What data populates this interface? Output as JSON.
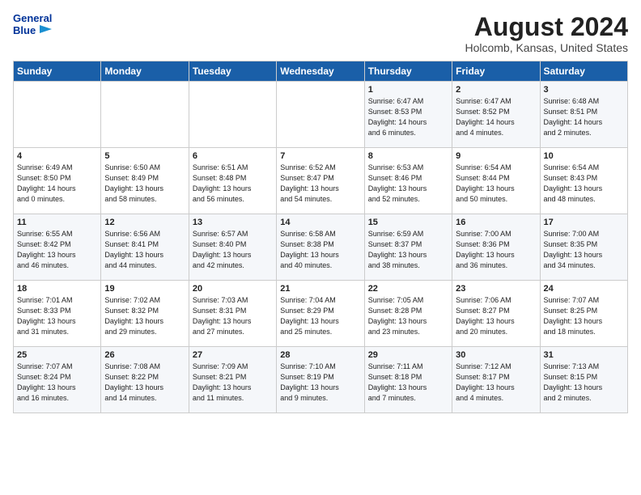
{
  "header": {
    "logo_line1": "General",
    "logo_line2": "Blue",
    "month_year": "August 2024",
    "location": "Holcomb, Kansas, United States"
  },
  "weekdays": [
    "Sunday",
    "Monday",
    "Tuesday",
    "Wednesday",
    "Thursday",
    "Friday",
    "Saturday"
  ],
  "weeks": [
    [
      {
        "day": "",
        "info": ""
      },
      {
        "day": "",
        "info": ""
      },
      {
        "day": "",
        "info": ""
      },
      {
        "day": "",
        "info": ""
      },
      {
        "day": "1",
        "info": "Sunrise: 6:47 AM\nSunset: 8:53 PM\nDaylight: 14 hours\nand 6 minutes."
      },
      {
        "day": "2",
        "info": "Sunrise: 6:47 AM\nSunset: 8:52 PM\nDaylight: 14 hours\nand 4 minutes."
      },
      {
        "day": "3",
        "info": "Sunrise: 6:48 AM\nSunset: 8:51 PM\nDaylight: 14 hours\nand 2 minutes."
      }
    ],
    [
      {
        "day": "4",
        "info": "Sunrise: 6:49 AM\nSunset: 8:50 PM\nDaylight: 14 hours\nand 0 minutes."
      },
      {
        "day": "5",
        "info": "Sunrise: 6:50 AM\nSunset: 8:49 PM\nDaylight: 13 hours\nand 58 minutes."
      },
      {
        "day": "6",
        "info": "Sunrise: 6:51 AM\nSunset: 8:48 PM\nDaylight: 13 hours\nand 56 minutes."
      },
      {
        "day": "7",
        "info": "Sunrise: 6:52 AM\nSunset: 8:47 PM\nDaylight: 13 hours\nand 54 minutes."
      },
      {
        "day": "8",
        "info": "Sunrise: 6:53 AM\nSunset: 8:46 PM\nDaylight: 13 hours\nand 52 minutes."
      },
      {
        "day": "9",
        "info": "Sunrise: 6:54 AM\nSunset: 8:44 PM\nDaylight: 13 hours\nand 50 minutes."
      },
      {
        "day": "10",
        "info": "Sunrise: 6:54 AM\nSunset: 8:43 PM\nDaylight: 13 hours\nand 48 minutes."
      }
    ],
    [
      {
        "day": "11",
        "info": "Sunrise: 6:55 AM\nSunset: 8:42 PM\nDaylight: 13 hours\nand 46 minutes."
      },
      {
        "day": "12",
        "info": "Sunrise: 6:56 AM\nSunset: 8:41 PM\nDaylight: 13 hours\nand 44 minutes."
      },
      {
        "day": "13",
        "info": "Sunrise: 6:57 AM\nSunset: 8:40 PM\nDaylight: 13 hours\nand 42 minutes."
      },
      {
        "day": "14",
        "info": "Sunrise: 6:58 AM\nSunset: 8:38 PM\nDaylight: 13 hours\nand 40 minutes."
      },
      {
        "day": "15",
        "info": "Sunrise: 6:59 AM\nSunset: 8:37 PM\nDaylight: 13 hours\nand 38 minutes."
      },
      {
        "day": "16",
        "info": "Sunrise: 7:00 AM\nSunset: 8:36 PM\nDaylight: 13 hours\nand 36 minutes."
      },
      {
        "day": "17",
        "info": "Sunrise: 7:00 AM\nSunset: 8:35 PM\nDaylight: 13 hours\nand 34 minutes."
      }
    ],
    [
      {
        "day": "18",
        "info": "Sunrise: 7:01 AM\nSunset: 8:33 PM\nDaylight: 13 hours\nand 31 minutes."
      },
      {
        "day": "19",
        "info": "Sunrise: 7:02 AM\nSunset: 8:32 PM\nDaylight: 13 hours\nand 29 minutes."
      },
      {
        "day": "20",
        "info": "Sunrise: 7:03 AM\nSunset: 8:31 PM\nDaylight: 13 hours\nand 27 minutes."
      },
      {
        "day": "21",
        "info": "Sunrise: 7:04 AM\nSunset: 8:29 PM\nDaylight: 13 hours\nand 25 minutes."
      },
      {
        "day": "22",
        "info": "Sunrise: 7:05 AM\nSunset: 8:28 PM\nDaylight: 13 hours\nand 23 minutes."
      },
      {
        "day": "23",
        "info": "Sunrise: 7:06 AM\nSunset: 8:27 PM\nDaylight: 13 hours\nand 20 minutes."
      },
      {
        "day": "24",
        "info": "Sunrise: 7:07 AM\nSunset: 8:25 PM\nDaylight: 13 hours\nand 18 minutes."
      }
    ],
    [
      {
        "day": "25",
        "info": "Sunrise: 7:07 AM\nSunset: 8:24 PM\nDaylight: 13 hours\nand 16 minutes."
      },
      {
        "day": "26",
        "info": "Sunrise: 7:08 AM\nSunset: 8:22 PM\nDaylight: 13 hours\nand 14 minutes."
      },
      {
        "day": "27",
        "info": "Sunrise: 7:09 AM\nSunset: 8:21 PM\nDaylight: 13 hours\nand 11 minutes."
      },
      {
        "day": "28",
        "info": "Sunrise: 7:10 AM\nSunset: 8:19 PM\nDaylight: 13 hours\nand 9 minutes."
      },
      {
        "day": "29",
        "info": "Sunrise: 7:11 AM\nSunset: 8:18 PM\nDaylight: 13 hours\nand 7 minutes."
      },
      {
        "day": "30",
        "info": "Sunrise: 7:12 AM\nSunset: 8:17 PM\nDaylight: 13 hours\nand 4 minutes."
      },
      {
        "day": "31",
        "info": "Sunrise: 7:13 AM\nSunset: 8:15 PM\nDaylight: 13 hours\nand 2 minutes."
      }
    ]
  ]
}
